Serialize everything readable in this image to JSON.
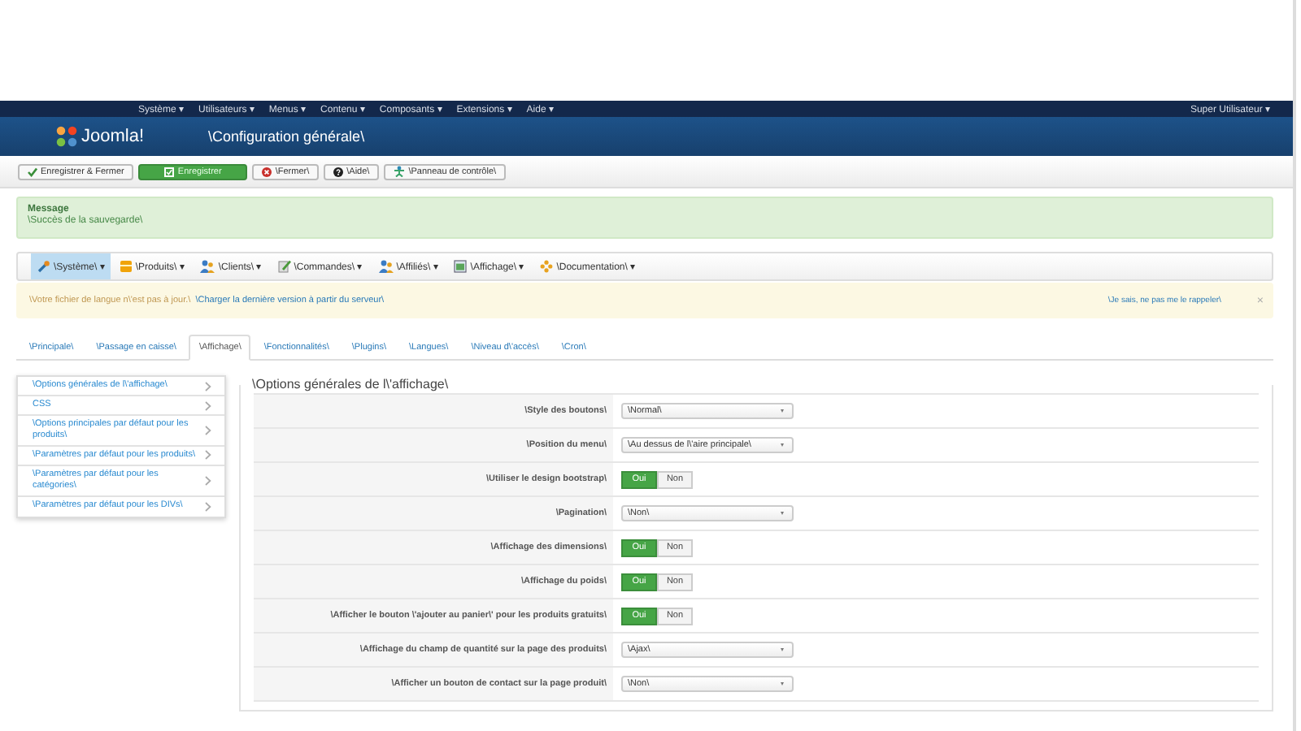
{
  "top_menu": {
    "items": [
      "Système ▾",
      "Utilisateurs ▾",
      "Menus ▾",
      "Contenu ▾",
      "Composants ▾",
      "Extensions ▾",
      "Aide ▾"
    ],
    "user": "Super Utilisateur ▾"
  },
  "header": {
    "logo": "Joomla!",
    "title": "\\Configuration générale\\"
  },
  "toolbar": [
    {
      "label": "Enregistrer & Fermer",
      "kind": "check"
    },
    {
      "label": "Enregistrer",
      "kind": "primary"
    },
    {
      "label": "\\Fermer\\",
      "kind": "close"
    },
    {
      "label": "\\Aide\\",
      "kind": "help"
    },
    {
      "label": "\\Panneau de contrôle\\",
      "kind": "panel"
    }
  ],
  "message": {
    "title": "Message",
    "text": "\\Succès de la sauvegarde\\"
  },
  "component_menu": [
    {
      "label": "\\Système\\ ▾",
      "kind": "wrench",
      "selected": true
    },
    {
      "label": "\\Produits\\ ▾",
      "kind": "box",
      "selected": false
    },
    {
      "label": "\\Clients\\ ▾",
      "kind": "people",
      "selected": false
    },
    {
      "label": "\\Commandes\\ ▾",
      "kind": "pencil",
      "selected": false
    },
    {
      "label": "\\Affiliés\\ ▾",
      "kind": "people",
      "selected": false
    },
    {
      "label": "\\Affichage\\ ▾",
      "kind": "window",
      "selected": false
    },
    {
      "label": "\\Documentation\\ ▾",
      "kind": "gear",
      "selected": false
    }
  ],
  "warning": {
    "text": "\\Votre fichier de langue n\\'est pas à jour.\\",
    "link": "\\Charger la dernière version à partir du serveur\\",
    "dismiss": "\\Je sais, ne pas me le rappeler\\",
    "close": "×"
  },
  "tabs": [
    {
      "label": "\\Principale\\",
      "selected": false
    },
    {
      "label": "\\Passage en caisse\\",
      "selected": false
    },
    {
      "label": "\\Affichage\\",
      "selected": true
    },
    {
      "label": "\\Fonctionnalités\\",
      "selected": false
    },
    {
      "label": "\\Plugins\\",
      "selected": false
    },
    {
      "label": "\\Langues\\",
      "selected": false
    },
    {
      "label": "\\Niveau d\\'accès\\",
      "selected": false
    },
    {
      "label": "\\Cron\\",
      "selected": false
    }
  ],
  "sidebar": {
    "items": [
      "\\Options générales de l\\'affichage\\",
      "CSS",
      "\\Options principales par défaut pour les produits\\",
      "\\Paramètres par défaut pour les produits\\",
      "\\Paramètres par défaut pour les catégories\\",
      "\\Paramètres par défaut pour les DIVs\\"
    ]
  },
  "fieldset": {
    "legend": "\\Options générales de l\\'affichage\\",
    "rows": [
      {
        "label": "\\Style des boutons\\",
        "kind": "select",
        "value": "\\Normal\\"
      },
      {
        "label": "\\Position du menu\\",
        "kind": "select",
        "value": "\\Au dessus de l\\'aire principale\\"
      },
      {
        "label": "\\Utiliser le design bootstrap\\",
        "kind": "toggle",
        "options": [
          {
            "label": "Oui",
            "selected": true
          },
          {
            "label": "Non",
            "selected": false
          }
        ]
      },
      {
        "label": "\\Pagination\\",
        "kind": "select",
        "value": "\\Non\\"
      },
      {
        "label": "\\Affichage des dimensions\\",
        "kind": "toggle",
        "options": [
          {
            "label": "Oui",
            "selected": true
          },
          {
            "label": "Non",
            "selected": false
          }
        ]
      },
      {
        "label": "\\Affichage du poids\\",
        "kind": "toggle",
        "options": [
          {
            "label": "Oui",
            "selected": true
          },
          {
            "label": "Non",
            "selected": false
          }
        ]
      },
      {
        "label": "\\Afficher le bouton \\'ajouter au panier\\' pour les produits gratuits\\",
        "kind": "toggle",
        "options": [
          {
            "label": "Oui",
            "selected": true
          },
          {
            "label": "Non",
            "selected": false
          }
        ]
      },
      {
        "label": "\\Affichage du champ de quantité sur la page des produits\\",
        "kind": "select",
        "value": "\\Ajax\\"
      },
      {
        "label": "\\Afficher un bouton de contact sur la page produit\\",
        "kind": "select",
        "value": "\\Non\\"
      }
    ]
  }
}
